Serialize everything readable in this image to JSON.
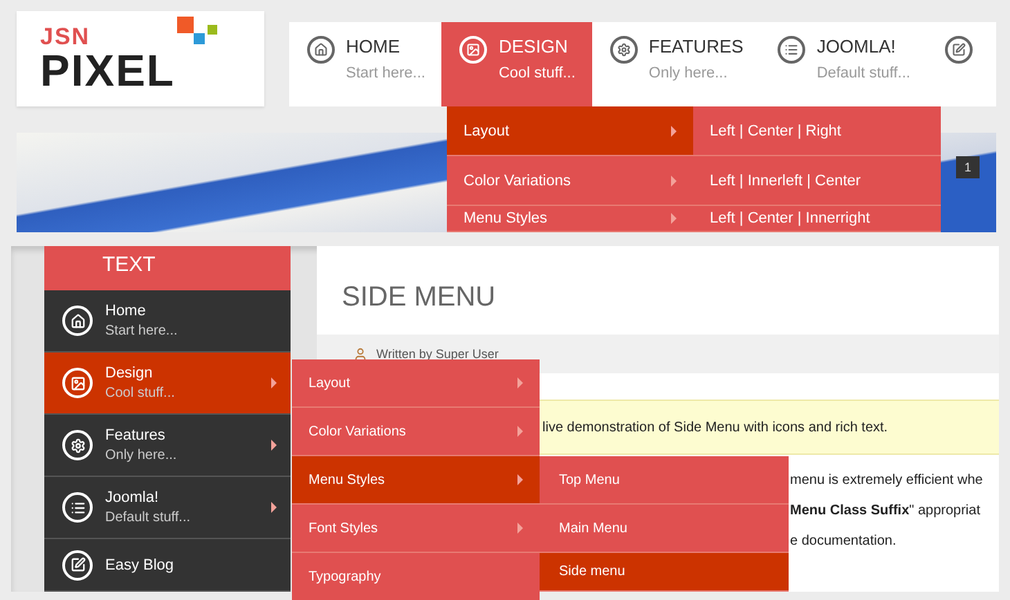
{
  "logo": {
    "top": "JSN",
    "main": "PIXEL"
  },
  "nav": {
    "items": [
      {
        "label": "HOME",
        "sub": "Start here...",
        "selected": false
      },
      {
        "label": "DESIGN",
        "sub": "Cool stuff...",
        "selected": true
      },
      {
        "label": "FEATURES",
        "sub": "Only here...",
        "selected": false
      },
      {
        "label": "JOOMLA!",
        "sub": "Default stuff...",
        "selected": false
      },
      {
        "selected": false
      }
    ]
  },
  "dropdown": {
    "items": [
      {
        "label": "Layout",
        "selected": true
      },
      {
        "label": "Color Variations",
        "selected": false
      },
      {
        "label": "Menu Styles",
        "selected": false
      }
    ],
    "submenu": [
      {
        "label": "Left | Center | Right",
        "selected": false
      },
      {
        "label": "Left | Innerleft | Center",
        "selected": false
      },
      {
        "label": "Left | Center | Innerright",
        "selected": false
      }
    ]
  },
  "slider": {
    "badge": "1"
  },
  "side_menu": {
    "title": "TEXT",
    "items": [
      {
        "label": "Home",
        "sub": "Start here...",
        "selected": false,
        "has_submenu": false
      },
      {
        "label": "Design",
        "sub": "Cool stuff...",
        "selected": true,
        "has_submenu": true
      },
      {
        "label": "Features",
        "sub": "Only here...",
        "selected": false,
        "has_submenu": true
      },
      {
        "label": "Joomla!",
        "sub": "Default stuff...",
        "selected": false,
        "has_submenu": true
      },
      {
        "label": "Easy Blog",
        "selected": false,
        "has_submenu": false
      }
    ],
    "submenu": [
      {
        "label": "Layout",
        "selected": false
      },
      {
        "label": "Color Variations",
        "selected": false
      },
      {
        "label": "Menu Styles",
        "selected": true
      },
      {
        "label": "Font Styles",
        "selected": false
      },
      {
        "label": "Typography",
        "selected": false
      }
    ],
    "subsubmenu": [
      {
        "label": "Top Menu",
        "selected": false
      },
      {
        "label": "Main Menu",
        "selected": false
      },
      {
        "label": "Side menu",
        "selected": true
      }
    ]
  },
  "article": {
    "title": "SIDE MENU",
    "author": "Written by Super User",
    "note": "live demonstration of Side Menu with icons and rich text.",
    "paragraphs": [
      "menu is extremely efficient whe",
      "**Menu Class Suffix**\" appropriat",
      "e documentation."
    ]
  }
}
